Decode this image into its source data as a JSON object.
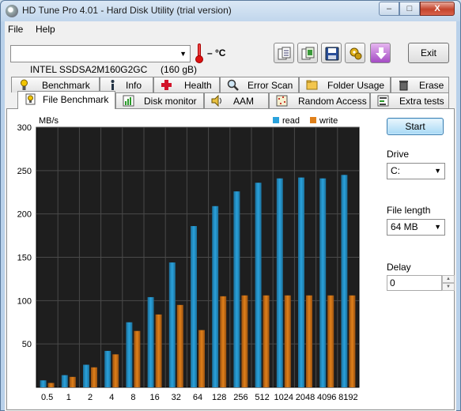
{
  "window": {
    "title": "HD Tune Pro 4.01 - Hard Disk Utility (trial version)",
    "min": "–",
    "max": "□",
    "close": "X"
  },
  "menu": {
    "file": "File",
    "help": "Help"
  },
  "toolbar": {
    "drive": "INTEL SSDSA2M160G2GC     (160 gB)",
    "temperature": "– °C",
    "exit": "Exit",
    "icons": [
      "copy-text-icon",
      "copy-screenshot-icon",
      "save-icon",
      "options-icon",
      "download-icon"
    ]
  },
  "tabs_row1": [
    {
      "label": "Benchmark",
      "icon": "benchmark-icon"
    },
    {
      "label": "Info",
      "icon": "info-icon"
    },
    {
      "label": "Health",
      "icon": "health-icon"
    },
    {
      "label": "Error Scan",
      "icon": "error-scan-icon"
    },
    {
      "label": "Folder Usage",
      "icon": "folder-icon"
    },
    {
      "label": "Erase",
      "icon": "erase-icon"
    }
  ],
  "tabs_row2": [
    {
      "label": "File Benchmark",
      "icon": "file-benchmark-icon",
      "active": true
    },
    {
      "label": "Disk monitor",
      "icon": "disk-monitor-icon"
    },
    {
      "label": "AAM",
      "icon": "aam-icon"
    },
    {
      "label": "Random Access",
      "icon": "random-access-icon"
    },
    {
      "label": "Extra tests",
      "icon": "extra-tests-icon"
    }
  ],
  "panel": {
    "start": "Start",
    "drive_label": "Drive",
    "drive_value": "C:",
    "file_length_label": "File length",
    "file_length_value": "64 MB",
    "delay_label": "Delay",
    "delay_value": "0"
  },
  "colors": {
    "read": "#2aa2dc",
    "write": "#e0801a",
    "plot_bg": "#1e1e1e"
  },
  "chart_data": {
    "type": "bar",
    "ylabel": "MB/s",
    "ylim": [
      0,
      300
    ],
    "yticks": [
      50,
      100,
      150,
      200,
      250,
      300
    ],
    "grid": true,
    "legend": "top-right",
    "categories": [
      "0.5",
      "1",
      "2",
      "4",
      "8",
      "16",
      "32",
      "64",
      "128",
      "256",
      "512",
      "1024",
      "2048",
      "4096",
      "8192"
    ],
    "series": [
      {
        "name": "read",
        "values": [
          8,
          14,
          26,
          42,
          75,
          104,
          144,
          186,
          209,
          226,
          236,
          241,
          242,
          241,
          245
        ]
      },
      {
        "name": "write",
        "values": [
          5,
          12,
          23,
          38,
          65,
          84,
          95,
          66,
          105,
          106,
          106,
          106,
          106,
          106,
          106
        ]
      }
    ]
  }
}
